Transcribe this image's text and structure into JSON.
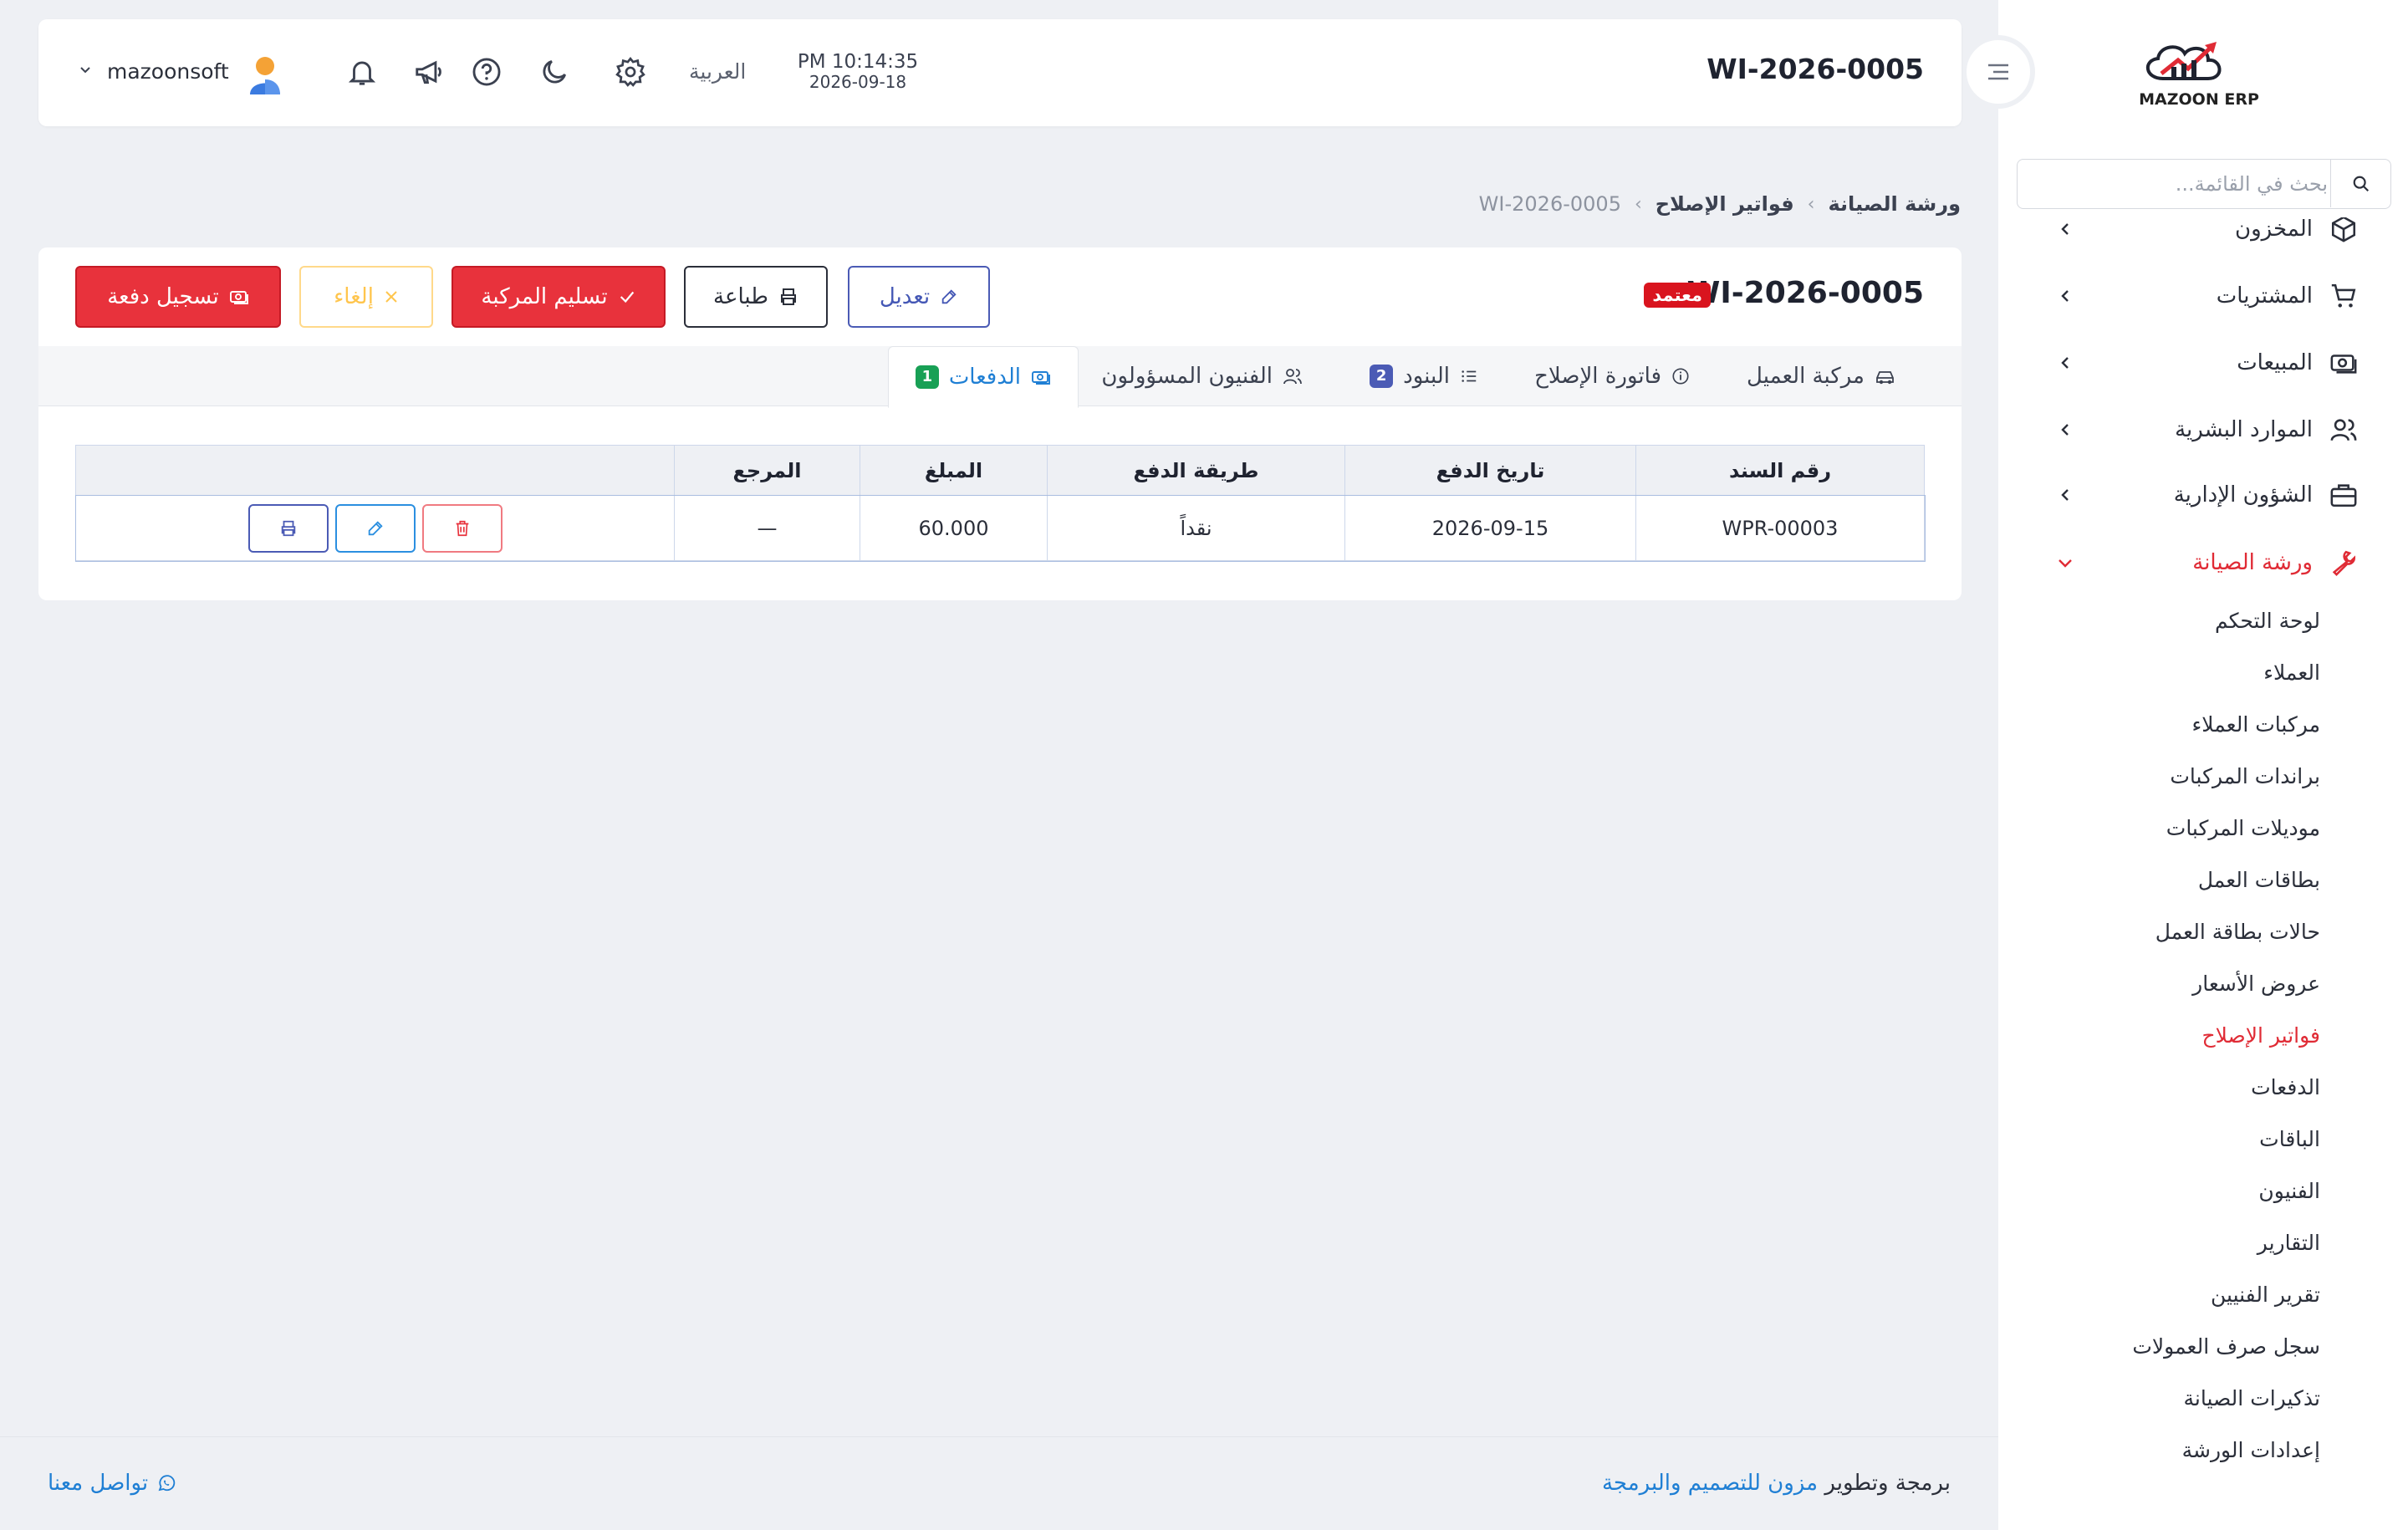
{
  "brand": {
    "logo_text": "MAZOON ERP"
  },
  "sidebar": {
    "search_placeholder": "بحث في القائمة...",
    "menu": [
      {
        "label": "المخزون",
        "icon": "box-icon"
      },
      {
        "label": "المشتريات",
        "icon": "cart-icon"
      },
      {
        "label": "المبيعات",
        "icon": "cash-icon"
      },
      {
        "label": "الموارد البشرية",
        "icon": "users-icon"
      },
      {
        "label": "الشؤون الإدارية",
        "icon": "briefcase-icon"
      },
      {
        "label": "ورشة الصيانة",
        "icon": "wrench-icon",
        "expanded": true
      }
    ],
    "submenu": [
      "لوحة التحكم",
      "العملاء",
      "مركبات العملاء",
      "براندات المركبات",
      "موديلات المركبات",
      "بطاقات العمل",
      "حالات بطاقة العمل",
      "عروض الأسعار",
      "فواتير الإصلاح",
      "الدفعات",
      "الباقات",
      "الفنيون",
      "التقارير",
      "تقرير الفنيين",
      "سجل صرف العمولات",
      "تذكيرات الصيانة",
      "إعدادات الورشة"
    ],
    "active_submenu": "فواتير الإصلاح"
  },
  "header": {
    "title": "WI-2026-0005",
    "time": "PM 10:14:35",
    "date": "2026-09-18",
    "language": "العربية",
    "user_name": "mazoonsoft",
    "icons": [
      "settings-icon",
      "moon-icon",
      "help-icon",
      "megaphone-icon",
      "bell-icon"
    ]
  },
  "breadcrumb": {
    "items": [
      "ورشة الصيانة",
      "فواتير الإصلاح"
    ],
    "current": "WI-2026-0005"
  },
  "invoice": {
    "number": "WI-2026-0005",
    "status": "معتمد",
    "actions": {
      "edit": "تعديل",
      "print": "طباعة",
      "deliver": "تسليم المركبة",
      "cancel": "إلغاء",
      "record_payment": "تسجيل دفعة"
    },
    "tabs": [
      {
        "label": "مركبة العميل",
        "icon": "car-icon"
      },
      {
        "label": "فاتورة الإصلاح",
        "icon": "info-icon"
      },
      {
        "label": "البنود",
        "icon": "list-icon",
        "count": "2"
      },
      {
        "label": "الفنيون المسؤولون",
        "icon": "users-icon"
      },
      {
        "label": "الدفعات",
        "icon": "cash-icon",
        "count": "1",
        "active": true
      }
    ],
    "payments": {
      "columns": [
        "رقم السند",
        "تاريخ الدفع",
        "طريقة الدفع",
        "المبلغ",
        "المرجع",
        ""
      ],
      "rows": [
        {
          "number": "WPR-00003",
          "date": "2026-09-15",
          "method": "نقداً",
          "amount": "60.000",
          "reference": "—"
        }
      ]
    }
  },
  "footer": {
    "credit_prefix": "برمجة وتطوير",
    "credit_brand": "مزون للتصميم والبرمجة",
    "contact": "تواصل معنا"
  },
  "colors": {
    "accent_red": "#e8323c",
    "accent_blue": "#1f7fd4",
    "amount_green": "#18a055",
    "edit_indigo": "#4b5bb5"
  }
}
